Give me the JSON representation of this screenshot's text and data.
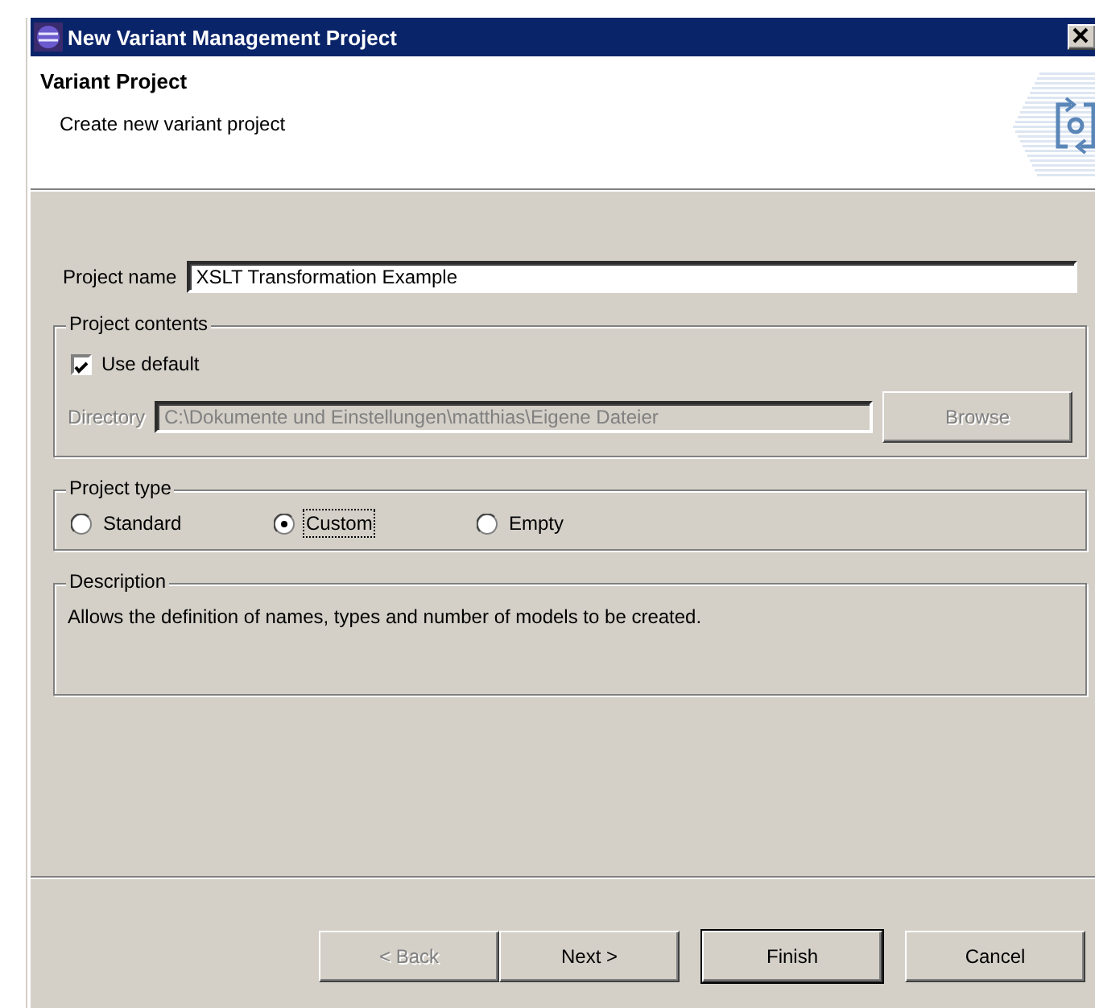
{
  "window": {
    "title": "New Variant Management Project"
  },
  "header": {
    "title": "Variant Project",
    "message": "Create new variant project"
  },
  "project_name": {
    "label": "Project name",
    "value": "XSLT Transformation Example"
  },
  "project_contents": {
    "title": "Project contents",
    "use_default": {
      "label": "Use default",
      "checked": true
    },
    "directory": {
      "label": "Directory",
      "value": "C:\\Dokumente und Einstellungen\\matthias\\Eigene Dateier",
      "disabled": true
    },
    "browse": {
      "label": "Browse",
      "disabled": true
    }
  },
  "project_type": {
    "title": "Project type",
    "options": [
      {
        "label": "Standard",
        "selected": false,
        "focused": false
      },
      {
        "label": "Custom",
        "selected": true,
        "focused": true
      },
      {
        "label": "Empty",
        "selected": false,
        "focused": false
      }
    ]
  },
  "description": {
    "title": "Description",
    "text": "Allows the definition of names, types and number of models to be created."
  },
  "buttons": [
    {
      "label": "< Back",
      "disabled": true,
      "default": false
    },
    {
      "label": "Next >",
      "disabled": false,
      "default": false
    },
    {
      "label": "Finish",
      "disabled": false,
      "default": true
    },
    {
      "label": "Cancel",
      "disabled": false,
      "default": false
    }
  ]
}
